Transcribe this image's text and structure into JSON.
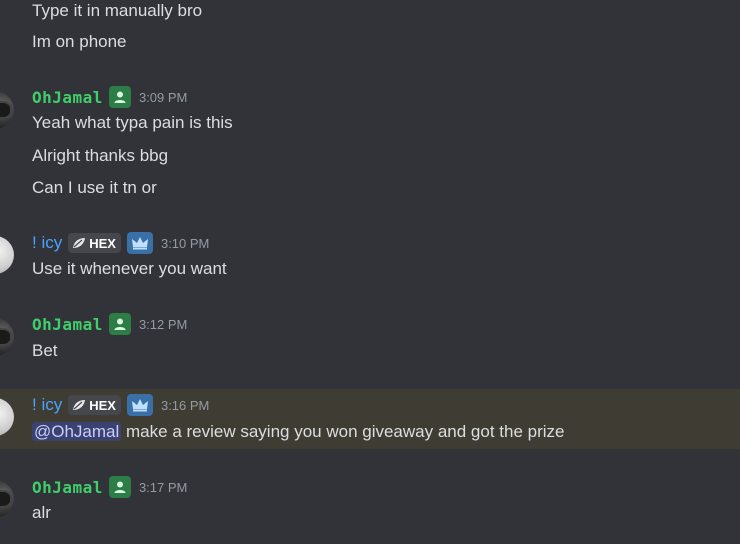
{
  "colors": {
    "background": "#313338",
    "highlight_row": "#3f3c34",
    "jamal_name": "#3fcf6a",
    "icy_name": "#4aa3ff",
    "timestamp": "#949ba4",
    "mention_bg": "#3c4270"
  },
  "messages": {
    "m0": {
      "lines": [
        "Type it in manually bro",
        "Im on phone"
      ]
    },
    "m1": {
      "author": "OhJamal",
      "time": "3:09 PM",
      "badge_icon": "user-role-icon",
      "lines": [
        "Yeah what typa pain is this",
        "Alright thanks bbg",
        "Can I use it tn or"
      ]
    },
    "m2": {
      "author": "! icy",
      "tag": "HEX",
      "tag_icon": "leaf-icon",
      "badge_icon": "crown-icon",
      "time": "3:10 PM",
      "lines": [
        "Use it whenever you want"
      ]
    },
    "m3": {
      "author": "OhJamal",
      "time": "3:12 PM",
      "badge_icon": "user-role-icon",
      "lines": [
        "Bet"
      ]
    },
    "m4": {
      "author": "! icy",
      "tag": "HEX",
      "tag_icon": "leaf-icon",
      "badge_icon": "crown-icon",
      "time": "3:16 PM",
      "mention": "@OhJamal",
      "text": " make a review saying you won giveaway and got the prize"
    },
    "m5": {
      "author": "OhJamal",
      "time": "3:17 PM",
      "badge_icon": "user-role-icon",
      "lines": [
        "alr"
      ]
    }
  }
}
